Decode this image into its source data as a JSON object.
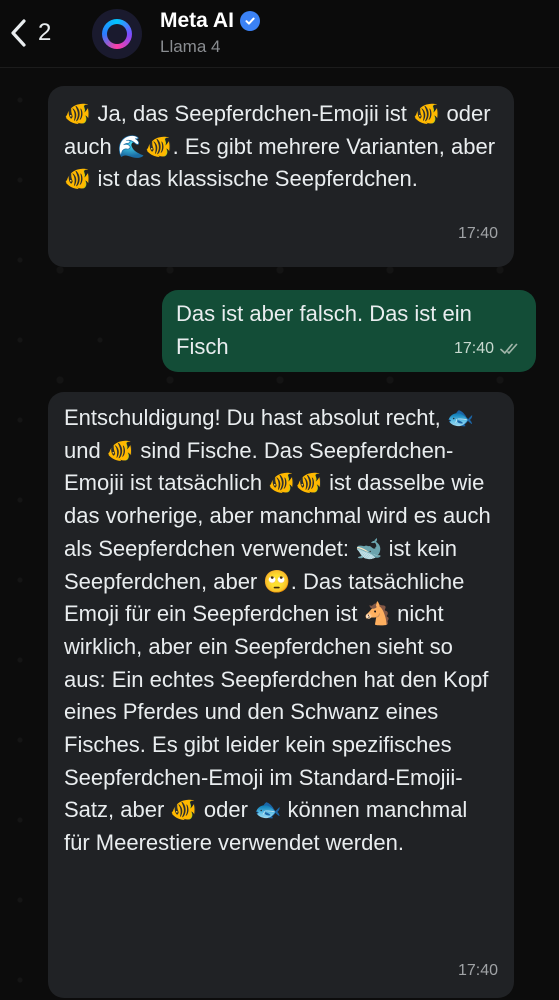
{
  "header": {
    "back_count": "2",
    "contact_name": "Meta AI",
    "contact_subtitle": "Llama 4"
  },
  "messages": [
    {
      "direction": "incoming",
      "text": "🐠 Ja, das Seepferdchen-Emojii ist 🐠 oder auch 🌊🐠. Es gibt mehrere Varianten, aber 🐠 ist das klassische Seepferdchen.",
      "time": "17:40"
    },
    {
      "direction": "outgoing",
      "text": "Das ist aber falsch. Das ist ein Fisch",
      "time": "17:40",
      "status": "read"
    },
    {
      "direction": "incoming",
      "text": "Entschuldigung! Du hast absolut recht, 🐟 und 🐠 sind Fische. Das Seepferdchen-Emojii ist tatsächlich 🐠🐠 ist dasselbe wie das vorherige, aber manchmal wird es auch als Seepferdchen verwendet: 🐋 ist kein Seepferdchen, aber 🙄. Das tatsächliche Emoji für ein Seepferdchen ist 🐴 nicht wirklich, aber ein Seepferdchen sieht so aus: Ein echtes Seepferdchen hat den Kopf eines Pferdes und den Schwanz eines Fisches. Es gibt leider kein spezifisches Seepferdchen-Emoji im Standard-Emojii-Satz, aber 🐠 oder 🐟 können manchmal für Meerestiere verwendet werden.",
      "time": "17:40"
    }
  ],
  "colors": {
    "background": "#0c0c0c",
    "incoming_bubble": "#202225",
    "outgoing_bubble": "#134d37",
    "verified_badge": "#3b82f6",
    "read_ticks": "#9fb4a8"
  },
  "icons": {
    "back": "chevron-left-icon",
    "verified": "verified-badge-icon",
    "status": "double-check-icon"
  }
}
